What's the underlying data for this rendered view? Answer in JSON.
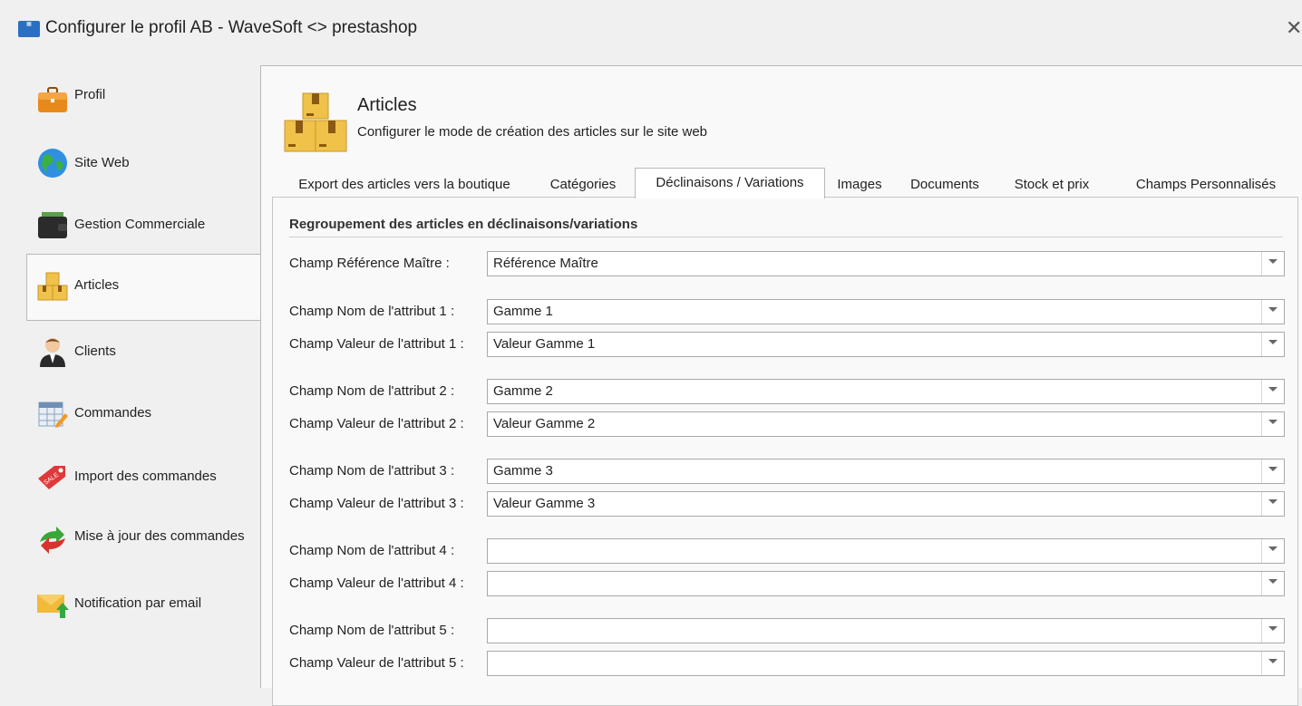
{
  "window": {
    "title": "Configurer le profil AB - WaveSoft <> prestashop",
    "close_glyph": "✕"
  },
  "sidebar": {
    "items": [
      {
        "label": "Profil",
        "icon": "briefcase-icon"
      },
      {
        "label": "Site Web",
        "icon": "globe-icon"
      },
      {
        "label": "Gestion Commerciale",
        "icon": "wallet-icon"
      },
      {
        "label": "Articles",
        "icon": "boxes-icon",
        "selected": true
      },
      {
        "label": "Clients",
        "icon": "person-icon"
      },
      {
        "label": "Commandes",
        "icon": "calendar-icon"
      },
      {
        "label": "Import des commandes",
        "icon": "sale-tag-icon"
      },
      {
        "label": "Mise à jour des commandes",
        "icon": "sync-arrows-icon"
      },
      {
        "label": "Notification par email",
        "icon": "email-icon"
      }
    ]
  },
  "header": {
    "title": "Articles",
    "subtitle": "Configurer le mode de création des articles sur le site web"
  },
  "tabs": [
    "Export des articles vers la boutique",
    "Catégories",
    "Déclinaisons / Variations",
    "Images",
    "Documents",
    "Stock et prix",
    "Champs Personnalisés"
  ],
  "active_tab": "Déclinaisons / Variations",
  "group": {
    "title": "Regroupement des articles en déclinaisons/variations",
    "fields": [
      {
        "label": "Champ Référence Maître :",
        "value": "Référence Maître"
      },
      {
        "label": "Champ Nom de l'attribut 1 :",
        "value": "Gamme 1"
      },
      {
        "label": "Champ Valeur de l'attribut 1 :",
        "value": "Valeur Gamme 1"
      },
      {
        "label": "Champ Nom de l'attribut 2 :",
        "value": "Gamme 2"
      },
      {
        "label": "Champ Valeur de l'attribut 2 :",
        "value": "Valeur Gamme 2"
      },
      {
        "label": "Champ Nom de l'attribut 3 :",
        "value": "Gamme 3"
      },
      {
        "label": "Champ Valeur de l'attribut 3 :",
        "value": "Valeur Gamme 3"
      },
      {
        "label": "Champ Nom de l'attribut 4 :",
        "value": ""
      },
      {
        "label": "Champ Valeur de l'attribut 4 :",
        "value": ""
      },
      {
        "label": "Champ Nom de l'attribut 5 :",
        "value": ""
      },
      {
        "label": "Champ Valeur de l'attribut 5 :",
        "value": ""
      }
    ]
  },
  "colors": {
    "window_bg": "#f0f0f0",
    "panel_bg": "#f9f9f9",
    "border": "#b9b9b9",
    "box_yellow": "#f0c24a"
  }
}
